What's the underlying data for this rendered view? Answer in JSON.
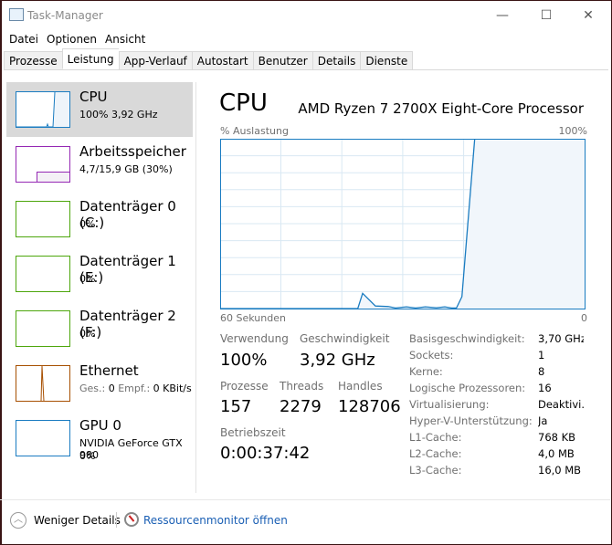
{
  "window": {
    "title": "Task-Manager",
    "minimize": "—",
    "maximize": "☐",
    "close": "✕"
  },
  "menu": [
    "Datei",
    "Optionen",
    "Ansicht"
  ],
  "tabs": [
    "Prozesse",
    "Leistung",
    "App-Verlauf",
    "Autostart",
    "Benutzer",
    "Details",
    "Dienste"
  ],
  "active_tab": "Leistung",
  "sidebar": [
    {
      "name": "CPU",
      "sub": "100% 3,92 GHz",
      "color": "#1a7cc1",
      "selected": true
    },
    {
      "name": "Arbeitsspeicher",
      "sub": "4,7/15,9 GB (30%)",
      "color": "#9528b4",
      "fraction": 0.3
    },
    {
      "name": "Datenträger 0 (C:)",
      "sub": "0%",
      "color": "#4da60c"
    },
    {
      "name": "Datenträger 1 (E:)",
      "sub": "0%",
      "color": "#4da60c"
    },
    {
      "name": "Datenträger 2 (F:)",
      "sub": "0%",
      "color": "#4da60c"
    },
    {
      "name": "Ethernet",
      "sub_label1": "Ges.:",
      "sub_val1": "0",
      "sub_label2": "Empf.:",
      "sub_val2": "0 KBit/s",
      "color": "#a74f01"
    },
    {
      "name": "GPU 0",
      "sub": "NVIDIA GeForce GTX 980",
      "sub2": "0%",
      "color": "#1a7cc1"
    }
  ],
  "main": {
    "title": "CPU",
    "processor": "AMD Ryzen 7 2700X Eight-Core Processor",
    "graph_label_left": "% Auslastung",
    "graph_label_right": "100%",
    "graph_bottom_left": "60 Sekunden",
    "graph_bottom_right": "0",
    "stats": {
      "usage_label": "Verwendung",
      "usage": "100%",
      "speed_label": "Geschwindigkeit",
      "speed": "3,92 GHz",
      "proc_label": "Prozesse",
      "proc": "157",
      "threads_label": "Threads",
      "threads": "2279",
      "handles_label": "Handles",
      "handles": "128706",
      "uptime_label": "Betriebszeit",
      "uptime": "0:00:37:42"
    },
    "details": [
      {
        "k": "Basisgeschwindigkeit:",
        "v": "3,70 GHz"
      },
      {
        "k": "Sockets:",
        "v": "1"
      },
      {
        "k": "Kerne:",
        "v": "8"
      },
      {
        "k": "Logische Prozessoren:",
        "v": "16"
      },
      {
        "k": "Virtualisierung:",
        "v": "Deaktivi..."
      },
      {
        "k": "Hyper-V-Unterstützung:",
        "v": "Ja"
      },
      {
        "k": "L1-Cache:",
        "v": "768 KB"
      },
      {
        "k": "L2-Cache:",
        "v": "4,0 MB"
      },
      {
        "k": "L3-Cache:",
        "v": "16,0 MB"
      }
    ]
  },
  "footer": {
    "less": "Weniger Details",
    "monitor": "Ressourcenmonitor öffnen"
  },
  "chart_data": {
    "type": "area",
    "title": "CPU",
    "ylabel": "% Auslastung",
    "xlabel": "60 Sekunden",
    "xlim": [
      60,
      0
    ],
    "ylim": [
      0,
      100
    ],
    "grid": true,
    "x": [
      60,
      37.4,
      36.6,
      34.5,
      32.4,
      31.2,
      29.4,
      27.9,
      26.3,
      24.5,
      23.1,
      22,
      21.2,
      20.3,
      18.2,
      0
    ],
    "y": [
      0,
      0,
      9,
      1.5,
      1.2,
      0.3,
      1,
      0.3,
      1,
      0.5,
      1,
      0.3,
      0.3,
      7,
      100,
      100
    ],
    "color": "#1a7cc1"
  }
}
